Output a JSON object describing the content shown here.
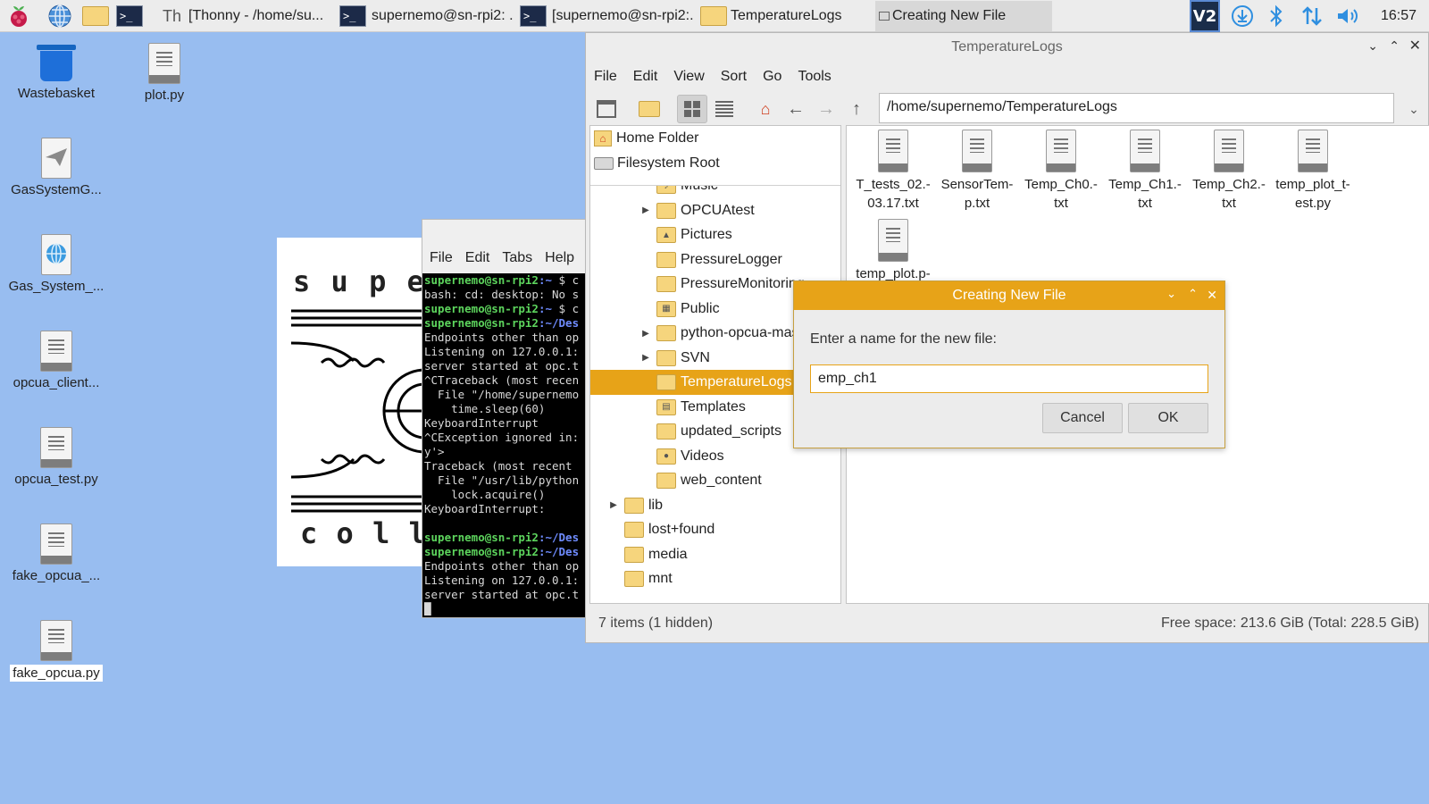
{
  "taskbar": {
    "tasks": [
      {
        "label": "[Thonny  -  /home/su...",
        "icon": "thonny-icon"
      },
      {
        "label": "supernemo@sn-rpi2: ...",
        "icon": "terminal-icon"
      },
      {
        "label": "[supernemo@sn-rpi2:...",
        "icon": "terminal-icon"
      },
      {
        "label": "TemperatureLogs",
        "icon": "folder-icon"
      },
      {
        "label": "Creating New File",
        "icon": "dialog-icon"
      }
    ],
    "clock": "16:57"
  },
  "desktop": {
    "icons": [
      {
        "label": "Wastebasket",
        "icon": "trash-icon"
      },
      {
        "label": "plot.py",
        "icon": "file-icon"
      },
      {
        "label": "GasSystemG...",
        "icon": "send-icon"
      },
      {
        "label": "Gas_System_...",
        "icon": "web-icon"
      },
      {
        "label": "opcua_client...",
        "icon": "file-icon"
      },
      {
        "label": "opcua_test.py",
        "icon": "file-icon"
      },
      {
        "label": "fake_opcua_...",
        "icon": "file-icon"
      },
      {
        "label": "fake_opcua.py",
        "icon": "file-icon"
      }
    ]
  },
  "logo": {
    "top_text": "s u p e",
    "bottom_text": "c o l l a b"
  },
  "terminal": {
    "menu": [
      "File",
      "Edit",
      "Tabs",
      "Help"
    ],
    "lines": [
      {
        "prompt": "supernemo@sn-rpi2",
        "path": ":~",
        "text": " $ c"
      },
      {
        "prompt": "",
        "path": "",
        "text": "bash: cd: desktop: No s"
      },
      {
        "prompt": "supernemo@sn-rpi2",
        "path": ":~",
        "text": " $ c"
      },
      {
        "prompt": "supernemo@sn-rpi2",
        "path": ":~/Des",
        "text": ""
      },
      {
        "prompt": "",
        "path": "",
        "text": "Endpoints other than op"
      },
      {
        "prompt": "",
        "path": "",
        "text": "Listening on 127.0.0.1:"
      },
      {
        "prompt": "",
        "path": "",
        "text": "server started at opc.t"
      },
      {
        "prompt": "",
        "path": "",
        "text": "^CTraceback (most recen"
      },
      {
        "prompt": "",
        "path": "",
        "text": "  File \"/home/supernemo"
      },
      {
        "prompt": "",
        "path": "",
        "text": "    time.sleep(60)"
      },
      {
        "prompt": "",
        "path": "",
        "text": "KeyboardInterrupt"
      },
      {
        "prompt": "",
        "path": "",
        "text": "^CException ignored in:"
      },
      {
        "prompt": "",
        "path": "",
        "text": "y'>"
      },
      {
        "prompt": "",
        "path": "",
        "text": "Traceback (most recent"
      },
      {
        "prompt": "",
        "path": "",
        "text": "  File \"/usr/lib/python"
      },
      {
        "prompt": "",
        "path": "",
        "text": "    lock.acquire()"
      },
      {
        "prompt": "",
        "path": "",
        "text": "KeyboardInterrupt:"
      },
      {
        "prompt": "",
        "path": "",
        "text": ""
      },
      {
        "prompt": "supernemo@sn-rpi2",
        "path": ":~/Des",
        "text": ""
      },
      {
        "prompt": "supernemo@sn-rpi2",
        "path": ":~/Des",
        "text": ""
      },
      {
        "prompt": "",
        "path": "",
        "text": "Endpoints other than op"
      },
      {
        "prompt": "",
        "path": "",
        "text": "Listening on 127.0.0.1:"
      },
      {
        "prompt": "",
        "path": "",
        "text": "server started at opc.t"
      },
      {
        "prompt": "",
        "path": "",
        "text": "█"
      }
    ]
  },
  "filemanager": {
    "title": "TemperatureLogs",
    "menu": [
      "File",
      "Edit",
      "View",
      "Sort",
      "Go",
      "Tools"
    ],
    "path": "/home/supernemo/TemperatureLogs",
    "places": [
      {
        "label": "Home Folder",
        "icon": "home-icon"
      },
      {
        "label": "Filesystem Root",
        "icon": "drive-icon"
      }
    ],
    "tree": [
      {
        "label": "Music",
        "level": 2,
        "expander": false,
        "icon": "music-folder-icon",
        "selected": false
      },
      {
        "label": "OPCUAtest",
        "level": 2,
        "expander": true,
        "icon": "folder-icon",
        "selected": false
      },
      {
        "label": "Pictures",
        "level": 2,
        "expander": false,
        "icon": "pictures-folder-icon",
        "selected": false
      },
      {
        "label": "PressureLogger",
        "level": 2,
        "expander": false,
        "icon": "folder-icon",
        "selected": false
      },
      {
        "label": "PressureMonitoring",
        "level": 2,
        "expander": false,
        "icon": "folder-icon",
        "selected": false
      },
      {
        "label": "Public",
        "level": 2,
        "expander": false,
        "icon": "public-folder-icon",
        "selected": false
      },
      {
        "label": "python-opcua-master",
        "level": 2,
        "expander": true,
        "icon": "folder-icon",
        "selected": false
      },
      {
        "label": "SVN",
        "level": 2,
        "expander": true,
        "icon": "folder-icon",
        "selected": false
      },
      {
        "label": "TemperatureLogs",
        "level": 2,
        "expander": false,
        "icon": "folder-icon",
        "selected": true
      },
      {
        "label": "Templates",
        "level": 2,
        "expander": false,
        "icon": "templates-folder-icon",
        "selected": false
      },
      {
        "label": "updated_scripts",
        "level": 2,
        "expander": false,
        "icon": "folder-icon",
        "selected": false
      },
      {
        "label": "Videos",
        "level": 2,
        "expander": false,
        "icon": "videos-folder-icon",
        "selected": false
      },
      {
        "label": "web_content",
        "level": 2,
        "expander": false,
        "icon": "folder-icon",
        "selected": false
      },
      {
        "label": "lib",
        "level": 1,
        "expander": true,
        "icon": "folder-icon",
        "selected": false
      },
      {
        "label": "lost+found",
        "level": 1,
        "expander": false,
        "icon": "folder-icon",
        "selected": false
      },
      {
        "label": "media",
        "level": 1,
        "expander": false,
        "icon": "folder-icon",
        "selected": false
      },
      {
        "label": "mnt",
        "level": 1,
        "expander": false,
        "icon": "folder-icon",
        "selected": false
      }
    ],
    "files": [
      {
        "line1": "T_tests_02.-",
        "line2": "03.17.txt"
      },
      {
        "line1": "SensorTem-",
        "line2": "p.txt"
      },
      {
        "line1": "Temp_Ch0.-",
        "line2": "txt"
      },
      {
        "line1": "Temp_Ch1.-",
        "line2": "txt"
      },
      {
        "line1": "Temp_Ch2.-",
        "line2": "txt"
      },
      {
        "line1": "temp_plot_t-",
        "line2": "est.py"
      },
      {
        "line1": "temp_plot.p-",
        "line2": ""
      }
    ],
    "status_left": "7 items (1 hidden)",
    "status_right": "Free space: 213.6 GiB (Total: 228.5 GiB)"
  },
  "dialog": {
    "title": "Creating New File",
    "prompt": "Enter a name for the new file:",
    "input_value": "emp_ch1",
    "cancel_label": "Cancel",
    "ok_label": "OK"
  },
  "colors": {
    "desktop": "#98bdf0",
    "accent": "#e7a318",
    "panel": "#ececec"
  }
}
